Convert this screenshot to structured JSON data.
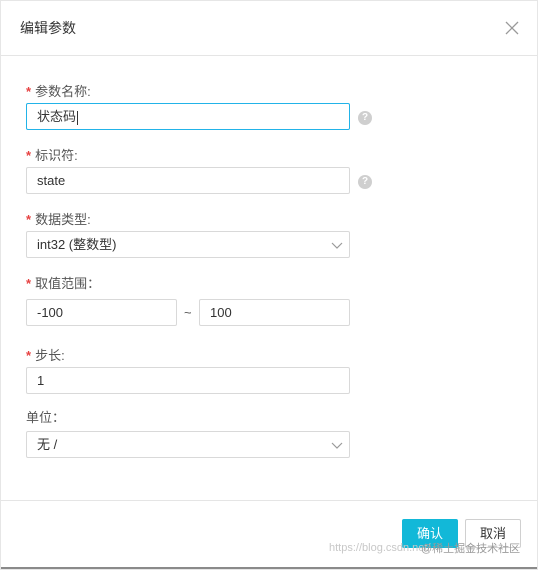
{
  "dialog": {
    "title": "编辑参数",
    "close_icon": "close-icon"
  },
  "fields": {
    "param_name": {
      "label": "参数名称:",
      "required": "*",
      "value": "状态码"
    },
    "identifier": {
      "label": "标识符:",
      "required": "*",
      "value": "state"
    },
    "data_type": {
      "label": "数据类型:",
      "required": "*",
      "value": "int32 (整数型)"
    },
    "value_range": {
      "label": "取值范围：",
      "required": "*",
      "min": "-100",
      "separator": "~",
      "max": "100"
    },
    "step": {
      "label": "步长:",
      "required": "*",
      "value": "1"
    },
    "unit": {
      "label": "单位：",
      "value": "无 /"
    }
  },
  "help_icon_glyph": "?",
  "buttons": {
    "confirm": "确认",
    "cancel": "取消"
  },
  "watermark": {
    "url_text": "https://blog.csdn.net/",
    "brand_text": "@稀土掘金技术社区"
  },
  "colors": {
    "accent": "#12b8d8",
    "required": "#e64242",
    "focus_border": "#22b3e8"
  }
}
